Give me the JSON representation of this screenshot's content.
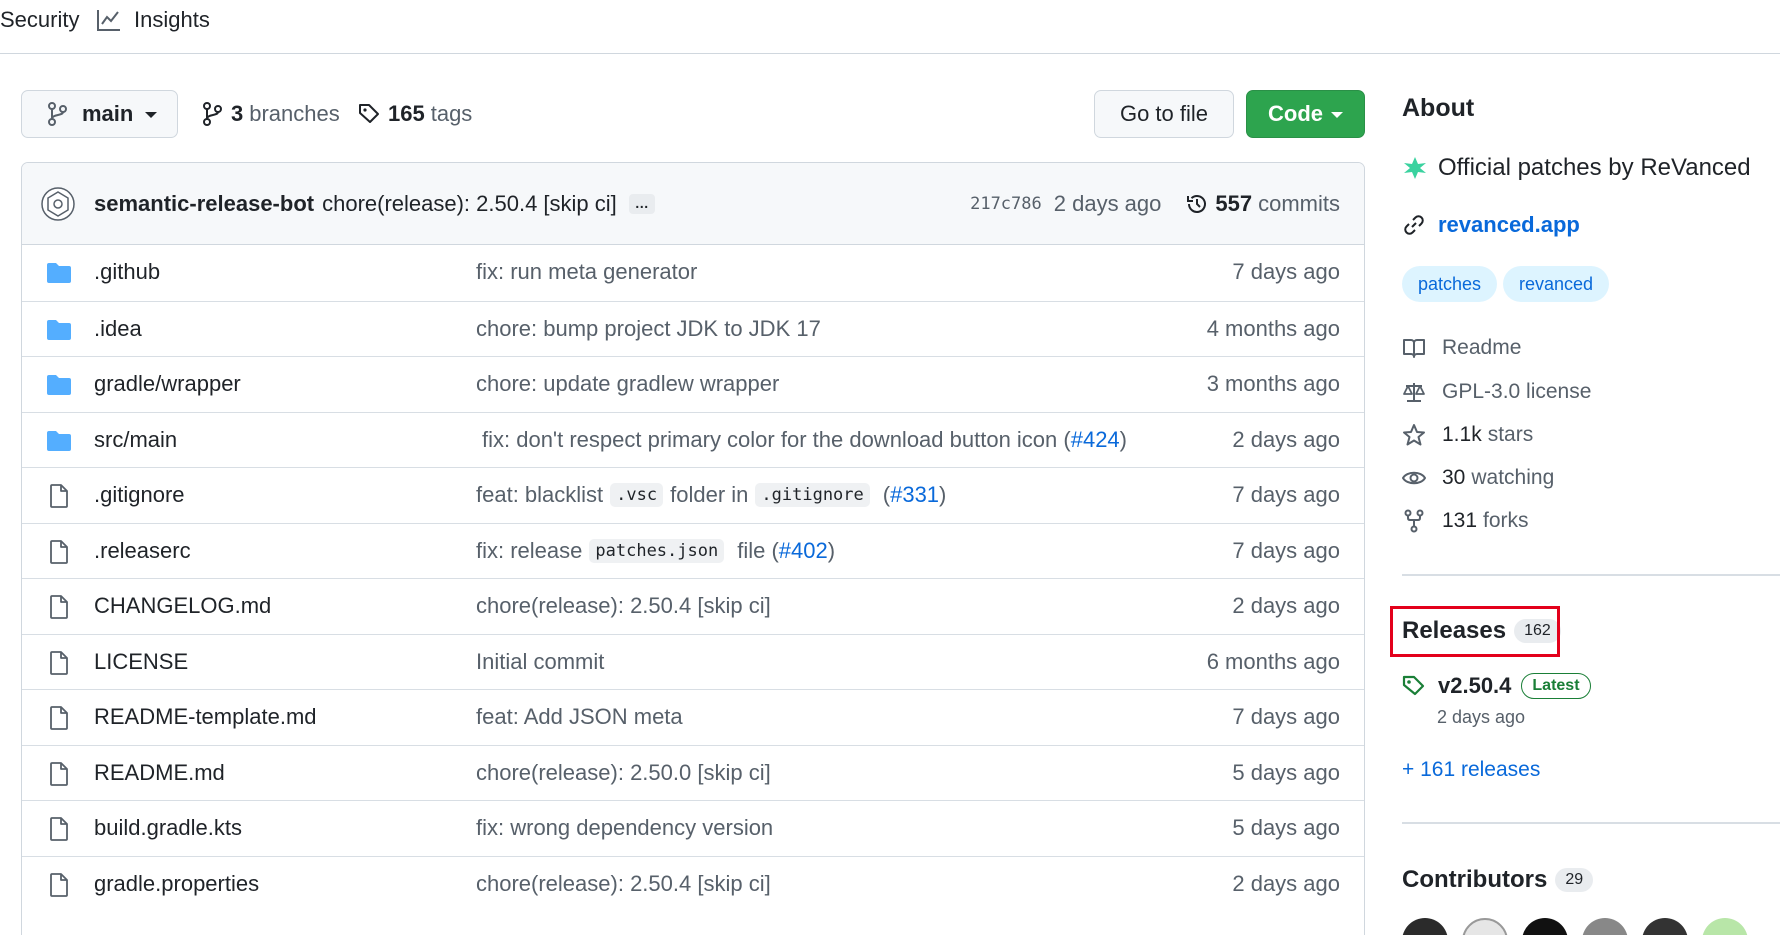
{
  "nav": {
    "security_label": "Security",
    "insights_label": "Insights"
  },
  "toolbar": {
    "branch": "main",
    "branches_count": "3",
    "branches_label": "branches",
    "tags_count": "165",
    "tags_label": "tags",
    "goto_file_label": "Go to file",
    "code_label": "Code"
  },
  "commit": {
    "author": "semantic-release-bot",
    "message": "chore(release): 2.50.4 [skip ci]",
    "ellipsis": "…",
    "sha": "217c786",
    "when": "2 days ago",
    "commit_count": "557",
    "commits_label": "commits"
  },
  "files": [
    {
      "type": "folder",
      "name": ".github",
      "message": "fix: run meta generator",
      "time": "7 days ago"
    },
    {
      "type": "folder",
      "name": ".idea",
      "message": "chore: bump project JDK to JDK 17",
      "time": "4 months ago"
    },
    {
      "type": "folder",
      "name": "gradle/wrapper",
      "message": "chore: update gradlew wrapper",
      "time": "3 months ago"
    },
    {
      "type": "folder",
      "name": "src/main",
      "message_parts": [
        "fix: don't respect primary color for the download button icon (",
        "#424",
        ")"
      ],
      "time": "2 days ago"
    },
    {
      "type": "file",
      "name": ".gitignore",
      "message_parts": [
        "feat: blacklist",
        ".vsc",
        "folder in",
        ".gitignore",
        "(",
        "#331",
        ")"
      ],
      "time": "7 days ago"
    },
    {
      "type": "file",
      "name": ".releaserc",
      "message_parts": [
        "fix: release",
        "patches.json",
        "file (",
        "#402",
        ")"
      ],
      "time": "7 days ago"
    },
    {
      "type": "file",
      "name": "CHANGELOG.md",
      "message": "chore(release): 2.50.4 [skip ci]",
      "time": "2 days ago"
    },
    {
      "type": "file",
      "name": "LICENSE",
      "message": "Initial commit",
      "time": "6 months ago"
    },
    {
      "type": "file",
      "name": "README-template.md",
      "message": "feat: Add JSON meta",
      "time": "7 days ago"
    },
    {
      "type": "file",
      "name": "README.md",
      "message": "chore(release): 2.50.0 [skip ci]",
      "time": "5 days ago"
    },
    {
      "type": "file",
      "name": "build.gradle.kts",
      "message": "fix: wrong dependency version",
      "time": "5 days ago"
    },
    {
      "type": "file",
      "name": "gradle.properties",
      "message": "chore(release): 2.50.4 [skip ci]",
      "time": "2 days ago"
    }
  ],
  "about": {
    "heading": "About",
    "description": "Official patches by ReVanced",
    "website": "revanced.app",
    "topics": [
      "patches",
      "revanced"
    ],
    "readme_label": "Readme",
    "license_label": "GPL-3.0 license",
    "stars_count": "1.1k",
    "stars_label": "stars",
    "watching_count": "30",
    "watching_label": "watching",
    "forks_count": "131",
    "forks_label": "forks"
  },
  "releases": {
    "heading": "Releases",
    "count": "162",
    "latest_version": "v2.50.4",
    "latest_badge": "Latest",
    "latest_date": "2 days ago",
    "more_label": "+ 161 releases"
  },
  "contributors": {
    "heading": "Contributors",
    "count": "29"
  },
  "colors": {
    "accent_blue": "#0969da",
    "code_green": "#2da44e",
    "highlight_red": "#e3001b",
    "folder_blue": "#54aeff"
  }
}
